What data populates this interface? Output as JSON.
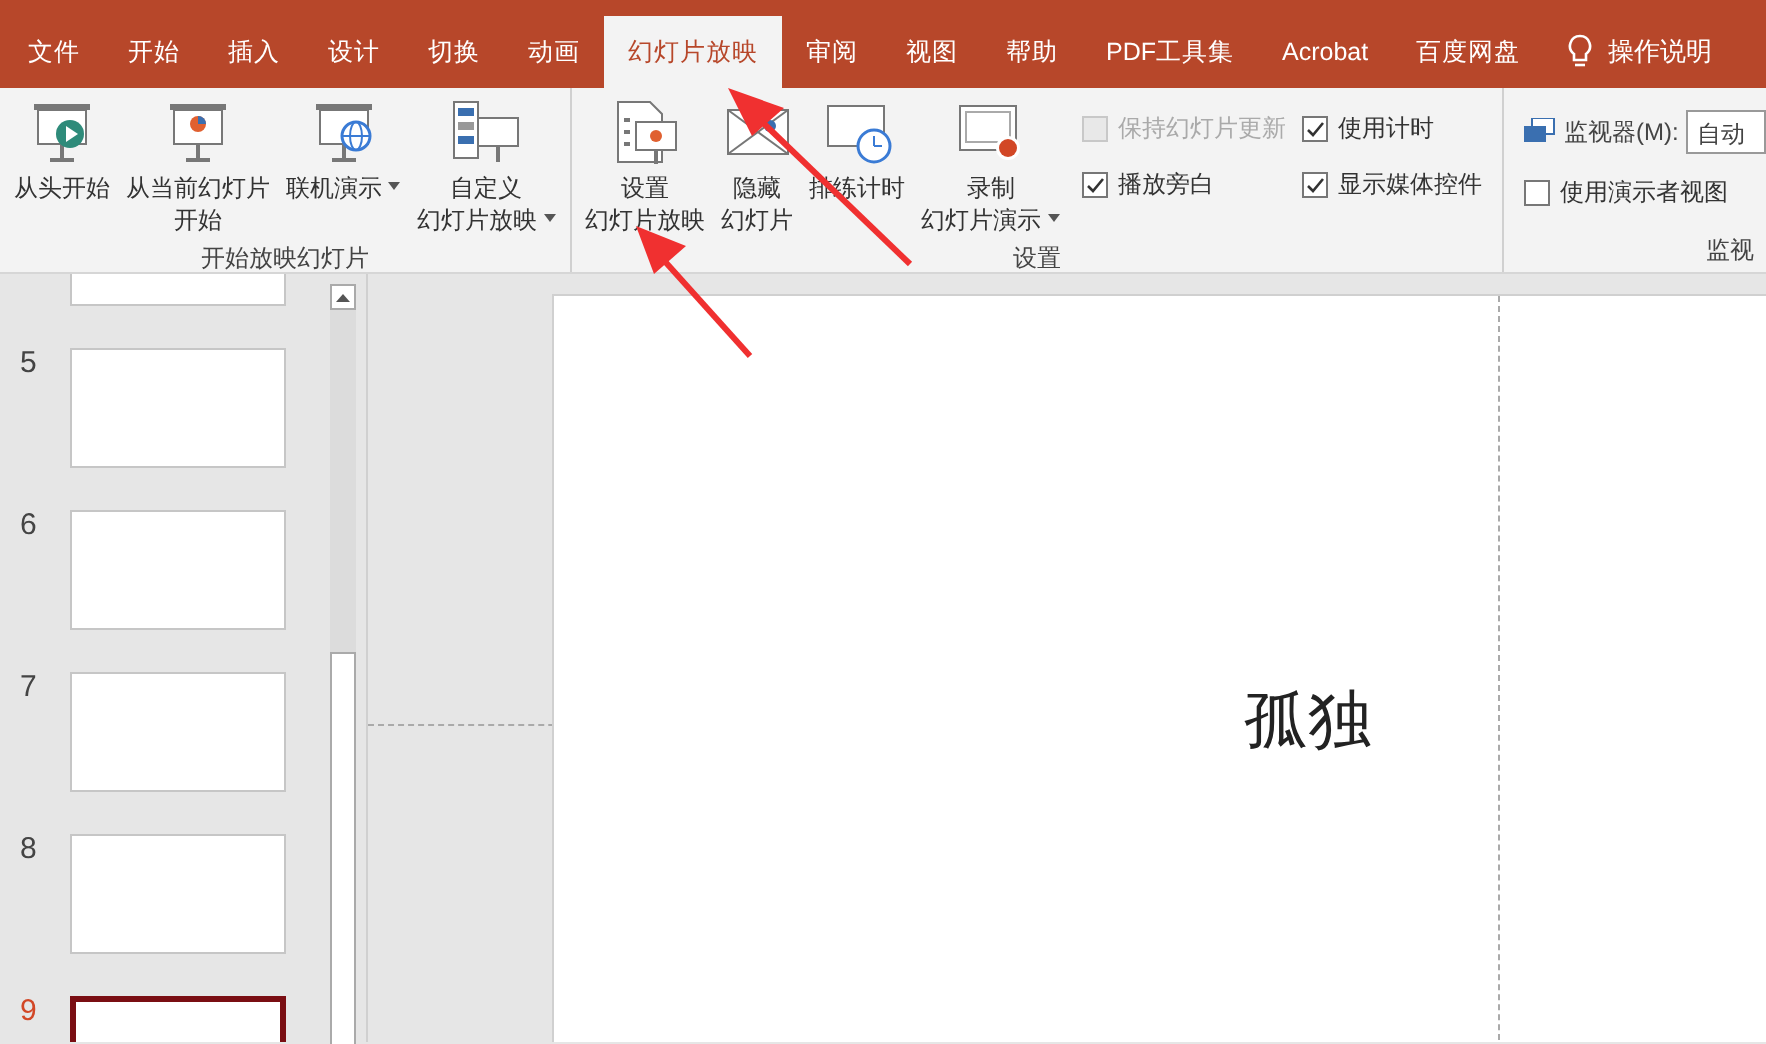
{
  "tabs": [
    {
      "label": "文件",
      "selected": false
    },
    {
      "label": "开始",
      "selected": false
    },
    {
      "label": "插入",
      "selected": false
    },
    {
      "label": "设计",
      "selected": false
    },
    {
      "label": "切换",
      "selected": false
    },
    {
      "label": "动画",
      "selected": false
    },
    {
      "label": "幻灯片放映",
      "selected": true
    },
    {
      "label": "审阅",
      "selected": false
    },
    {
      "label": "视图",
      "selected": false
    },
    {
      "label": "帮助",
      "selected": false
    },
    {
      "label": "PDF工具集",
      "selected": false
    },
    {
      "label": "Acrobat",
      "selected": false
    },
    {
      "label": "百度网盘",
      "selected": false
    }
  ],
  "tell_me": {
    "label": "操作说明"
  },
  "ribbon_groups": [
    {
      "label": "开始放映幻灯片",
      "buttons": [
        {
          "lines": [
            "从头开始"
          ],
          "dropdown": false
        },
        {
          "lines": [
            "从当前幻灯片",
            "开始"
          ],
          "dropdown": false
        },
        {
          "lines": [
            "联机演示"
          ],
          "dropdown": true
        },
        {
          "lines": [
            "自定义",
            "幻灯片放映"
          ],
          "dropdown": true
        }
      ]
    },
    {
      "label": "设置",
      "buttons": [
        {
          "lines": [
            "设置",
            "幻灯片放映"
          ],
          "dropdown": false
        },
        {
          "lines": [
            "隐藏",
            "幻灯片"
          ],
          "dropdown": false
        },
        {
          "lines": [
            "排练计时"
          ],
          "dropdown": false
        },
        {
          "lines": [
            "录制",
            "幻灯片演示"
          ],
          "dropdown": true
        }
      ],
      "controls": [
        {
          "kind": "check",
          "label": "保持幻灯片更新",
          "checked": false,
          "disabled": true
        },
        {
          "kind": "check",
          "label": "播放旁白",
          "checked": true,
          "disabled": false
        },
        {
          "kind": "check",
          "label": "使用计时",
          "checked": true,
          "disabled": false
        },
        {
          "kind": "check",
          "label": "显示媒体控件",
          "checked": true,
          "disabled": false
        }
      ]
    },
    {
      "label": "监视",
      "controls": [
        {
          "kind": "select",
          "label": "监视器(M):",
          "value": "自动"
        },
        {
          "kind": "check",
          "label": "使用演示者视图",
          "checked": false,
          "disabled": false
        }
      ]
    }
  ],
  "slides": [
    {
      "selected": false
    },
    {
      "number": "5",
      "selected": false
    },
    {
      "number": "6",
      "selected": false
    },
    {
      "number": "7",
      "selected": false
    },
    {
      "number": "8",
      "selected": false
    },
    {
      "number": "9",
      "selected": true
    }
  ],
  "slide": {
    "text": "孤独"
  }
}
